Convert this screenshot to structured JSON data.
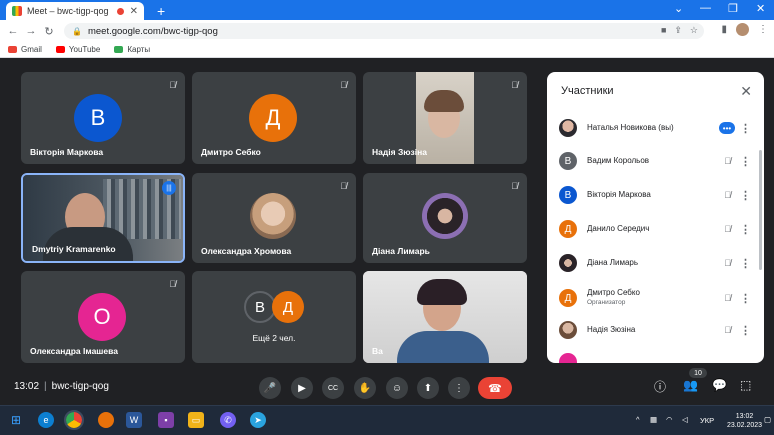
{
  "browser": {
    "tab_title": "Meet – bwc-tigp-qog",
    "url": "meet.google.com/bwc-tigp-qog",
    "bookmarks": [
      {
        "label": "Gmail",
        "color": "#ea4335"
      },
      {
        "label": "YouTube",
        "color": "#ff0000"
      },
      {
        "label": "Карты",
        "color": "#34a853"
      }
    ]
  },
  "tiles": [
    {
      "name": "Вікторія Маркова",
      "initial": "В",
      "color": "#0b57d0"
    },
    {
      "name": "Дмитро Себко",
      "initial": "Д",
      "color": "#e8710a"
    },
    {
      "name": "Надія Зюзіна"
    },
    {
      "name": "Dmytriy Kramarenko"
    },
    {
      "name": "Олександра Хромова"
    },
    {
      "name": "Діана Лимарь"
    },
    {
      "name": "Олександра Імашева",
      "initial": "О",
      "color": "#e52592"
    },
    {
      "name": "Ещё 2 чел.",
      "initials": [
        "В",
        "Д"
      ],
      "colors": [
        "#3c4043",
        "#e8710a"
      ]
    },
    {
      "name": "Ва"
    }
  ],
  "panel": {
    "title": "Участники",
    "participants": [
      {
        "name": "Наталья Новикова (вы)",
        "initial": "",
        "color": "#9aa0a6"
      },
      {
        "name": "Вадим Корольов",
        "initial": "В",
        "color": "#5f6368"
      },
      {
        "name": "Вікторія Маркова",
        "initial": "В",
        "color": "#0b57d0"
      },
      {
        "name": "Данило Середич",
        "initial": "Д",
        "color": "#e8710a"
      },
      {
        "name": "Діана Лимарь",
        "initial": "",
        "color": "#5f6368"
      },
      {
        "name": "Дмитро Себко",
        "role": "Организатор",
        "initial": "Д",
        "color": "#e8710a"
      },
      {
        "name": "Надія Зюзіна",
        "initial": "",
        "color": "#a08878"
      }
    ]
  },
  "meeting": {
    "time": "13:02",
    "code": "bwc-tigp-qog",
    "participants_count": "10"
  },
  "taskbar": {
    "lang": "УКР",
    "time": "13:02",
    "date": "23.02.2023"
  }
}
